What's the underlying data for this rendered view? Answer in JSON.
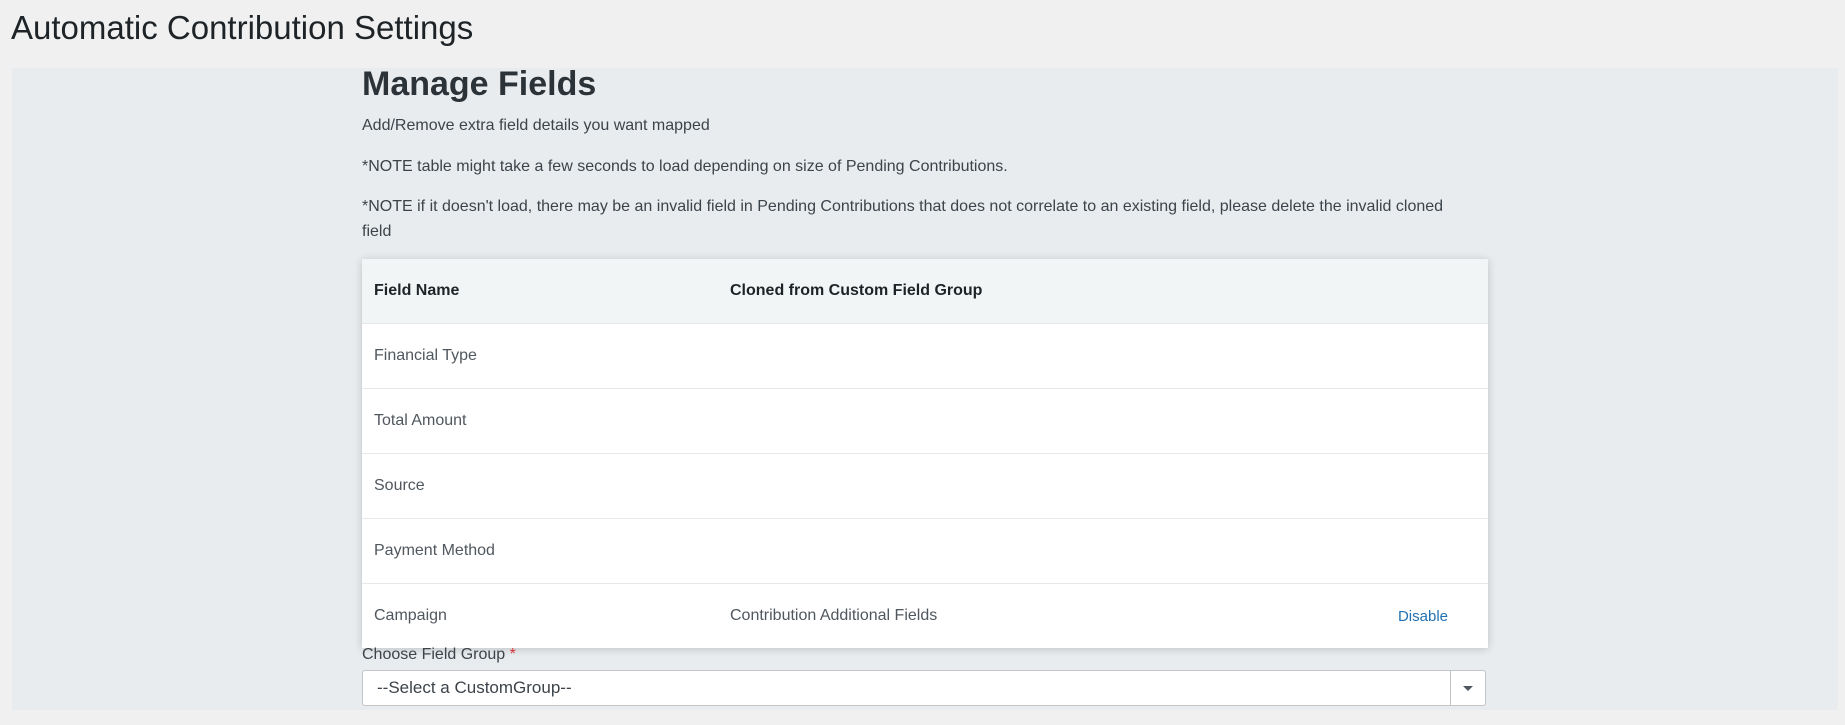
{
  "page": {
    "title": "Automatic Contribution Settings"
  },
  "manage_fields": {
    "title": "Manage Fields",
    "description": "Add/Remove extra field details you want mapped",
    "note1": "*NOTE table might take a few seconds to load depending on size of Pending Contributions.",
    "note2": "*NOTE if it doesn't load, there may be an invalid field in Pending Contributions that does not correlate to an existing field, please delete the invalid cloned field"
  },
  "table": {
    "headers": [
      "Field Name",
      "Cloned from Custom Field Group"
    ],
    "rows": [
      {
        "field_name": "Financial Type",
        "cloned_from": "",
        "action": ""
      },
      {
        "field_name": "Total Amount",
        "cloned_from": "",
        "action": ""
      },
      {
        "field_name": "Source",
        "cloned_from": "",
        "action": ""
      },
      {
        "field_name": "Payment Method",
        "cloned_from": "",
        "action": ""
      },
      {
        "field_name": "Campaign",
        "cloned_from": "Contribution Additional Fields",
        "action": "Disable"
      }
    ]
  },
  "field_group": {
    "label": "Choose Field Group",
    "required_marker": "*",
    "selected": "--Select a CustomGroup--"
  },
  "icons": {
    "select_arrow": "chevron-down-icon"
  },
  "colors": {
    "link": "#2271b1",
    "required": "#d63638",
    "panel_bg": "#e8ecee",
    "page_bg": "#f0f0f0"
  }
}
